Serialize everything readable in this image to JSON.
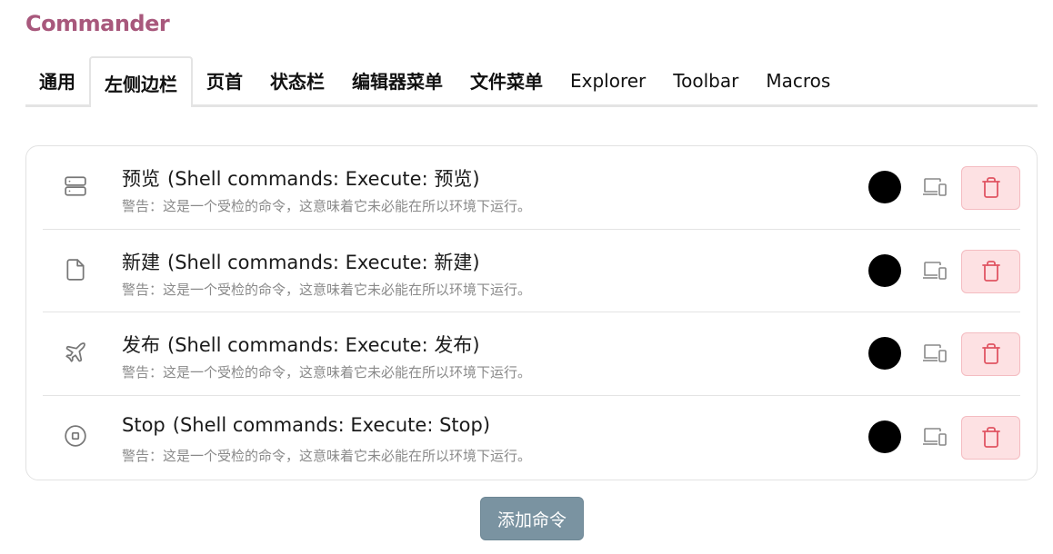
{
  "app": {
    "title": "Commander"
  },
  "tabs": [
    {
      "label": "通用",
      "cjk": true,
      "active": false
    },
    {
      "label": "左侧边栏",
      "cjk": true,
      "active": true
    },
    {
      "label": "页首",
      "cjk": true,
      "active": false
    },
    {
      "label": "状态栏",
      "cjk": true,
      "active": false
    },
    {
      "label": "编辑器菜单",
      "cjk": true,
      "active": false
    },
    {
      "label": "文件菜单",
      "cjk": true,
      "active": false
    },
    {
      "label": "Explorer",
      "cjk": false,
      "active": false
    },
    {
      "label": "Toolbar",
      "cjk": false,
      "active": false
    },
    {
      "label": "Macros",
      "cjk": false,
      "active": false
    }
  ],
  "commands": [
    {
      "icon": "server-icon",
      "name": "预览",
      "command": "(Shell commands: Execute: 预览)",
      "warning": "警告：这是一个受检的命令，这意味着它未必能在所以环境下运行。",
      "color": "#000000"
    },
    {
      "icon": "file-icon",
      "name": "新建",
      "command": "(Shell commands: Execute: 新建)",
      "warning": "警告：这是一个受检的命令，这意味着它未必能在所以环境下运行。",
      "color": "#000000"
    },
    {
      "icon": "plane-icon",
      "name": "发布",
      "command": "(Shell commands: Execute: 发布)",
      "warning": "警告：这是一个受检的命令，这意味着它未必能在所以环境下运行。",
      "color": "#000000"
    },
    {
      "icon": "stop-circle-icon",
      "name": "Stop",
      "command": "(Shell commands: Execute: Stop)",
      "warning": "警告：这是一个受检的命令，这意味着它未必能在所以环境下运行。",
      "color": "#000000"
    }
  ],
  "add_button": {
    "label": "添加命令"
  },
  "colors": {
    "accent": "#a8587c",
    "delete_bg": "#fde1e3",
    "delete_icon": "#e05563",
    "add_button": "#7a93a1"
  }
}
